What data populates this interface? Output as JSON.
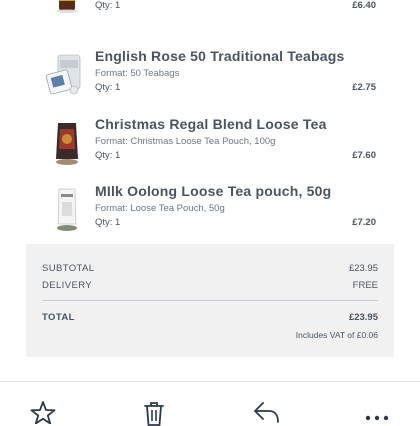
{
  "cart": {
    "items": [
      {
        "name": "",
        "format": "",
        "qty": "Qty: 1",
        "price": "£6.40"
      },
      {
        "name": "English Rose 50 Traditional Teabags",
        "format": "Format: 50 Teabags",
        "qty": "Qty: 1",
        "price": "£2.75"
      },
      {
        "name": "Christmas Regal Blend Loose Tea",
        "format": "Format: Christmas Loose Tea Pouch, 100g",
        "qty": "Qty: 1",
        "price": "£7.60"
      },
      {
        "name": "MIlk Oolong Loose Tea pouch, 50g",
        "format": "Format: Loose Tea Pouch, 50g",
        "qty": "Qty: 1",
        "price": "£7.20"
      }
    ]
  },
  "summary": {
    "subtotal_label": "SUBTOTAL",
    "subtotal_value": "£23.95",
    "delivery_label": "DELIVERY",
    "delivery_value": "FREE",
    "total_label": "TOTAL",
    "total_value": "£23.95",
    "vat_note": "Includes VAT of £0.06"
  },
  "toolbar": {
    "icons": [
      "star-icon",
      "trash-icon",
      "reply-icon",
      "more-icon"
    ]
  },
  "colors": {
    "text": "#4a5563",
    "summary_bg": "#f1f1f1",
    "divider": "#c9c9d6"
  }
}
